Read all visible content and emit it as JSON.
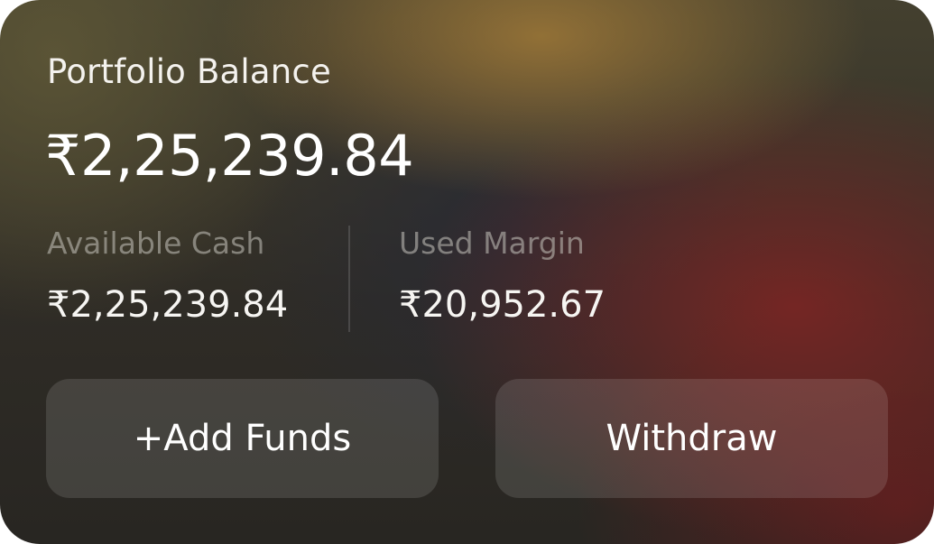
{
  "card": {
    "title": "Portfolio Balance",
    "balance": "₹2,25,239.84"
  },
  "stats": {
    "available_cash_label": "Available Cash",
    "available_cash_value": "₹2,25,239.84",
    "used_margin_label": "Used Margin",
    "used_margin_value": "₹20,952.67"
  },
  "actions": {
    "add_funds_label": "+Add Funds",
    "withdraw_label": "Withdraw"
  },
  "colors": {
    "text_primary": "#ffffff",
    "text_muted": "#8f8c86",
    "accent_gold": "#967337",
    "accent_red": "#782624"
  }
}
